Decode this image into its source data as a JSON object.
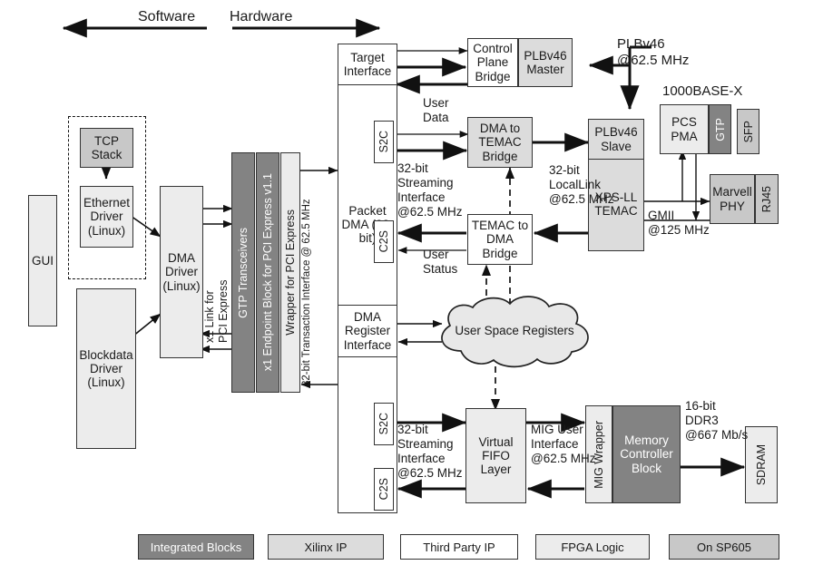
{
  "header": {
    "software_label": "Software",
    "hardware_label": "Hardware"
  },
  "blocks": {
    "gui": "GUI",
    "tcp_stack": "TCP\nStack",
    "ethernet_driver": "Ethernet\nDriver\n(Linux)",
    "blockdata_driver": "Blockdata\nDriver\n(Linux)",
    "dma_driver": "DMA\nDriver\n(Linux)",
    "gtp_transceivers": "GTP Transceivers",
    "endpoint_block": "x1 Endpoint Block for  PCI Express  v1.1",
    "wrapper_pcie": "Wrapper for PCI Express",
    "packet_dma": "Packet\nDMA\n(32-bit)",
    "target_interface": "Target\nInterface",
    "dma_register_interface": "DMA\nRegister\nInterface",
    "port_s2c_top": "S2C",
    "port_c2s_top": "C2S",
    "port_s2c_bottom": "S2C",
    "port_c2s_bottom": "C2S",
    "control_plane_bridge": "Control\nPlane\nBridge",
    "plbv46_master": "PLBv46\nMaster",
    "dma_to_temac_bridge": "DMA to\nTEMAC\nBridge",
    "temac_to_dma_bridge": "TEMAC to\nDMA\nBridge",
    "plbv46_slave": "PLBv46\nSlave",
    "xps_ll_temac": "XPS-LL\nTEMAC",
    "pcs_pma": "PCS\nPMA",
    "gtp": "GTP",
    "sfp": "SFP",
    "marvell_phy": "Marvell\nPHY",
    "rj45": "RJ45",
    "user_space_registers": "User Space Registers",
    "virtual_fifo_layer": "Virtual\nFIFO\nLayer",
    "mig_wrapper": "MIG Wrapper",
    "memory_controller_block": "Memory\nController\nBlock",
    "sdram": "SDRAM"
  },
  "annotations": {
    "x1_link_pcie": "x1 Link for\nPCI Express",
    "transaction_iface": "32-bit Transaction Interface @ 62.5 MHz",
    "user_data": "User\nData",
    "user_status": "User\nStatus",
    "streaming_top": "32-bit\nStreaming\nInterface\n@62.5 MHz",
    "streaming_bottom": "32-bit\nStreaming\nInterface\n@62.5 MHz",
    "locallink": "32-bit\nLocalLink\n@62.5 MHz",
    "plbv46_clock": "PLBv46\n@62.5 MHz",
    "base_x": "1000BASE-X",
    "gmii": "GMII\n@125 MHz",
    "mig_user_iface": "MIG User\nInterface\n@62.5 MHz",
    "ddr3": "16-bit\nDDR3\n@667 Mb/s"
  },
  "legend": [
    {
      "label": "Integrated Blocks",
      "style": "integ"
    },
    {
      "label": "Xilinx IP",
      "style": "xilinx"
    },
    {
      "label": "Third Party IP",
      "style": "white"
    },
    {
      "label": "FPGA Logic",
      "style": "fpga"
    },
    {
      "label": "On SP605",
      "style": "sp605"
    }
  ],
  "colors": {
    "integrated_blocks": "#838383",
    "xilinx_ip": "#dcdcdc",
    "third_party_ip": "#ffffff",
    "fpga_logic": "#ececec",
    "on_sp605": "#c8c8c8",
    "stroke": "#333333"
  }
}
